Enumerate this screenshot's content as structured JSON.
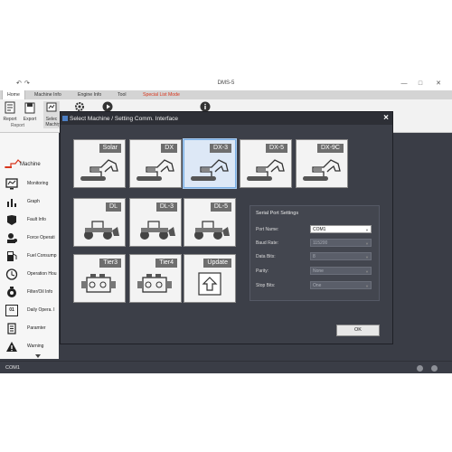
{
  "app": {
    "title": "DMS-5",
    "quick_access": [
      "↶",
      "↷"
    ],
    "window_controls": [
      "—",
      "□",
      "✕"
    ]
  },
  "menu": [
    {
      "label": "Home",
      "active": true
    },
    {
      "label": "Machine Info"
    },
    {
      "label": "Engine Info"
    },
    {
      "label": "Tool"
    },
    {
      "label": "Special List Mode",
      "special": true
    }
  ],
  "ribbon": {
    "report_label": "Report",
    "export_label": "Export",
    "select_label": "Selec\nMachi",
    "group_report": "Report",
    "group_t": "T"
  },
  "sidebar": {
    "header": "Machine",
    "items": [
      {
        "label": "Monitoring",
        "icon": "monitoring-icon"
      },
      {
        "label": "Graph",
        "icon": "graph-icon"
      },
      {
        "label": "Fault Info",
        "icon": "fault-icon"
      },
      {
        "label": "Force Operati",
        "icon": "force-icon"
      },
      {
        "label": "Fuel Consump",
        "icon": "fuel-icon"
      },
      {
        "label": "Operation Hou",
        "icon": "clock-icon"
      },
      {
        "label": "Filter/Oil Info",
        "icon": "filter-icon"
      },
      {
        "label": "Daily Opera. I",
        "icon": "calendar-icon"
      },
      {
        "label": "Paramter",
        "icon": "parameter-icon"
      },
      {
        "label": "Warning",
        "icon": "warning-icon"
      }
    ],
    "calendar_number": "01"
  },
  "status": {
    "port": "COM1"
  },
  "dialog": {
    "title": "Select Machine / Setting Comm. Interface",
    "tiles": [
      {
        "label": "Solar",
        "kind": "excavator"
      },
      {
        "label": "DX",
        "kind": "excavator"
      },
      {
        "label": "DX-3",
        "kind": "excavator",
        "selected": true
      },
      {
        "label": "DX-5",
        "kind": "excavator"
      },
      {
        "label": "DX-9C",
        "kind": "excavator"
      },
      {
        "label": "DL",
        "kind": "loader"
      },
      {
        "label": "DL-3",
        "kind": "loader"
      },
      {
        "label": "DL-5",
        "kind": "loader"
      },
      {
        "label": "Tier3",
        "kind": "engine"
      },
      {
        "label": "Tier4",
        "kind": "engine"
      },
      {
        "label": "Update",
        "kind": "update"
      }
    ],
    "serial": {
      "title": "Serial Port Settings",
      "rows": [
        {
          "label": "Port Name:",
          "value": "COM1",
          "active": true
        },
        {
          "label": "Baud Rate:",
          "value": "115200"
        },
        {
          "label": "Data Bits:",
          "value": "8"
        },
        {
          "label": "Parity:",
          "value": "None"
        },
        {
          "label": "Stop Bits:",
          "value": "One"
        }
      ]
    },
    "ok_label": "OK"
  },
  "colors": {
    "accent_red": "#d8351c",
    "dark_bg": "#3a3d46",
    "selected_tile": "#dde8f6"
  }
}
